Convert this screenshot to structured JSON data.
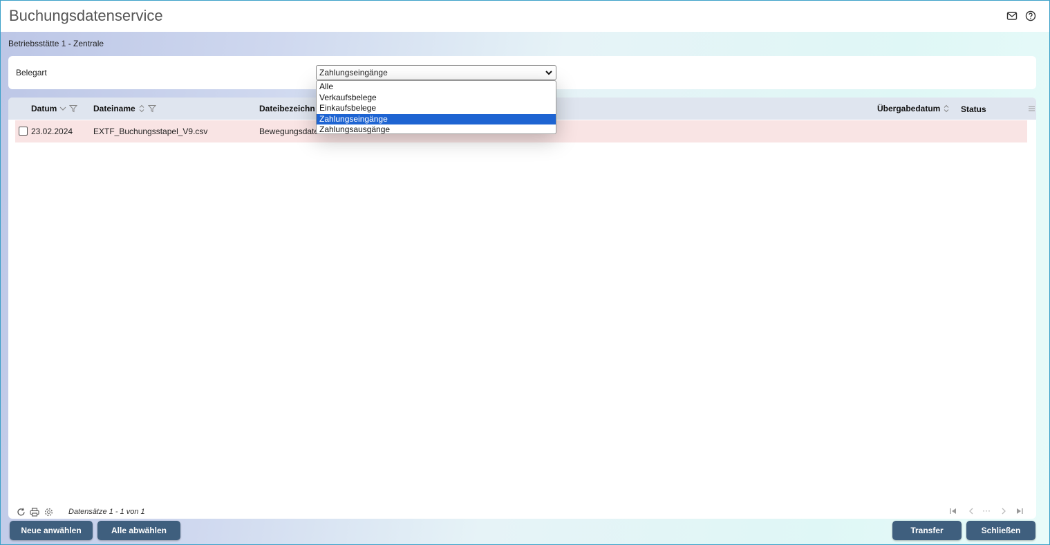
{
  "window": {
    "title": "Buchungsdatenservice"
  },
  "breadcrumb": "Betriebsstätte 1 - Zentrale",
  "filter": {
    "label": "Belegart",
    "selected": "Zahlungseingänge",
    "options": [
      "Alle",
      "Verkaufsbelege",
      "Einkaufsbelege",
      "Zahlungseingänge",
      "Zahlungsausgänge"
    ]
  },
  "grid": {
    "columns": {
      "datum": "Datum",
      "dateiname": "Dateiname",
      "dateibezeichnung": "Dateibezeichn",
      "uebergabedatum": "Übergabedatum",
      "status": "Status"
    },
    "rows": [
      {
        "datum": "23.02.2024",
        "dateiname": "EXTF_Buchungsstapel_V9.csv",
        "dateibezeichnung": "Bewegungsdate"
      }
    ],
    "records": "Datensätze 1 - 1 von 1",
    "pager_ellipsis": "···"
  },
  "buttons": {
    "neue_anwaehlen": "Neue anwählen",
    "alle_abwaehlen": "Alle abwählen",
    "transfer": "Transfer",
    "schliessen": "Schließen"
  },
  "icons": [
    "mail-icon",
    "help-icon",
    "sort-icon",
    "filter-icon",
    "menu-icon",
    "refresh-icon",
    "print-icon",
    "settings-icon",
    "first-page-icon",
    "prev-page-icon",
    "next-page-icon",
    "last-page-icon"
  ],
  "colors": {
    "accent": "#3f5f7e",
    "row_highlight": "#f9e4e4",
    "selected_option": "#1e64d2"
  }
}
